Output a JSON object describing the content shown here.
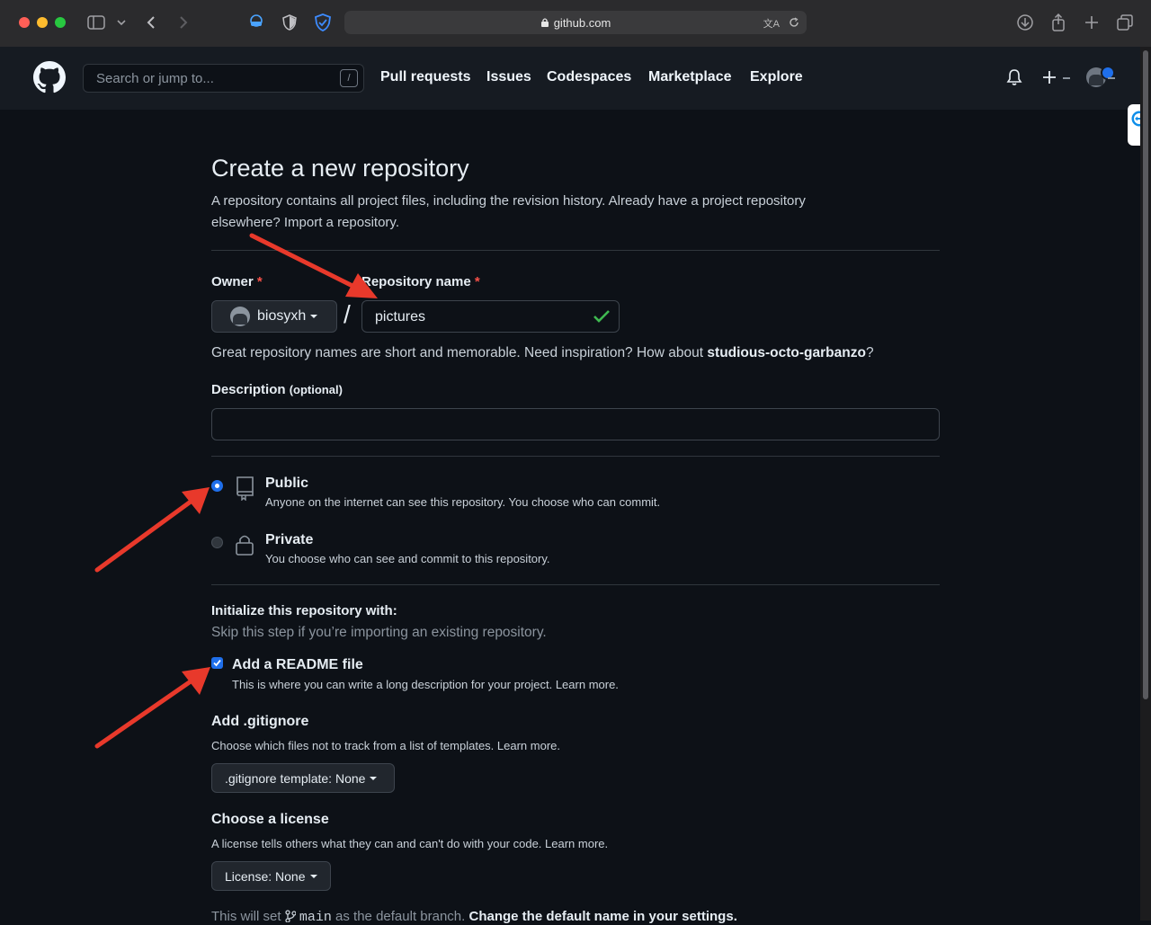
{
  "browser": {
    "url": "github.com"
  },
  "header": {
    "search_placeholder": "Search or jump to...",
    "slash_key": "/",
    "nav": [
      "Pull requests",
      "Issues",
      "Codespaces",
      "Marketplace",
      "Explore"
    ]
  },
  "page": {
    "title": "Create a new repository",
    "intro_line1": "A repository contains all project files, including the revision history. Already have a project repository",
    "intro_line2": "elsewhere? Import a repository.",
    "owner_label": "Owner",
    "required_mark": "*",
    "owner_value": "biosyxh",
    "separator": "/",
    "repo_name_label": "Repository name",
    "repo_name_value": "pictures",
    "name_hint_prefix": "Great repository names are short and memorable. Need inspiration? How about ",
    "name_suggestion": "studious-octo-garbanzo",
    "name_hint_suffix": "?",
    "description_label": "Description",
    "optional": "(optional)",
    "visibility": {
      "public_title": "Public",
      "public_desc": "Anyone on the internet can see this repository. You choose who can commit.",
      "private_title": "Private",
      "private_desc": "You choose who can see and commit to this repository.",
      "selected": "public"
    },
    "init_title": "Initialize this repository with:",
    "init_desc": "Skip this step if you’re importing an existing repository.",
    "readme_label": "Add a README file",
    "readme_desc": "This is where you can write a long description for your project. Learn more.",
    "readme_checked": true,
    "gitignore_title": "Add .gitignore",
    "gitignore_desc": "Choose which files not to track from a list of templates. Learn more.",
    "gitignore_button": ".gitignore template: None",
    "license_title": "Choose a license",
    "license_desc": "A license tells others what they can and can't do with your code. Learn more.",
    "license_button": "License: None",
    "branch_prefix": "This will set ",
    "branch_name": "main",
    "branch_suffix": " as the default branch. ",
    "branch_link": "Change the default name in your settings."
  },
  "colors": {
    "accent_blue": "#1f6feb",
    "success_green": "#3fb950",
    "annotation_red": "#e8392b"
  }
}
